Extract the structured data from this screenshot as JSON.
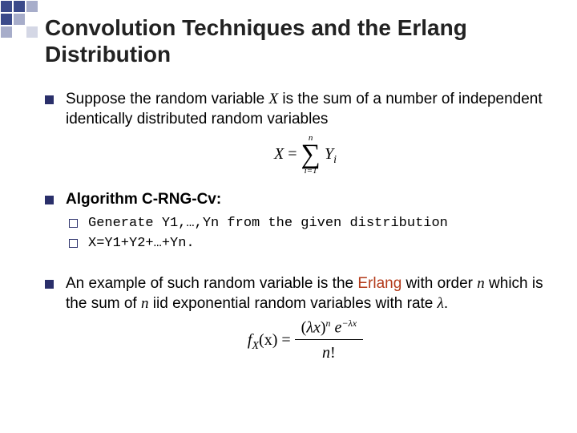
{
  "title": "Convolution Techniques and the Erlang Distribution",
  "bullet1": {
    "pre": "Suppose the random variable ",
    "var": "X",
    "post": " is the sum of a number of independent identically distributed random variables"
  },
  "eq1": {
    "lhs_var": "X",
    "equals": " = ",
    "sum_top": "n",
    "sum_bot": "i=1",
    "rhs_var": "Y",
    "rhs_sub": "i"
  },
  "bullet2": "Algorithm C-RNG-Cv:",
  "sub1": "Generate Y1,…,Yn from the given distribution",
  "sub2": "X=Y1+Y2+…+Yn.",
  "bullet3": {
    "pre": "An example of such random variable is the ",
    "erlang": "Erlang",
    "mid1": " with order ",
    "n1": "n",
    "mid2": " which is the sum of ",
    "n2": "n",
    "mid3": " iid exponential random variables with rate ",
    "lambda": "λ",
    "post": "."
  },
  "eq2": {
    "fxx": "f",
    "fsubX": "X",
    "arg": "(x) = ",
    "num_open": "(",
    "num_lambda1": "λx",
    "num_close": ")",
    "num_pow": "n",
    "sp": " ",
    "e": "e",
    "epow": "−λx",
    "den_n": "n",
    "den_fact": "!"
  }
}
